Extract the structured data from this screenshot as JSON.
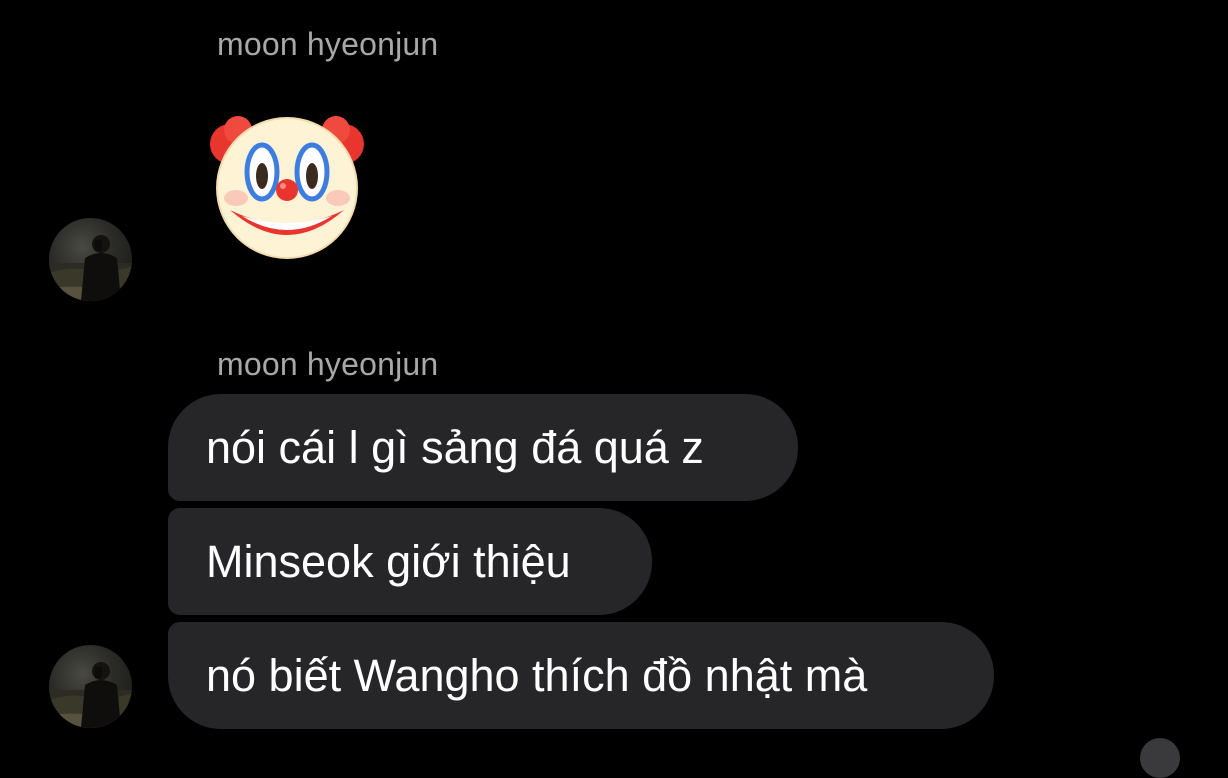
{
  "colors": {
    "background": "#000000",
    "bubble": "#262629",
    "sender_name": "#a8a8a8",
    "message_text": "#ffffff"
  },
  "groups": [
    {
      "sender": "moon hyeonjun",
      "messages": [
        {
          "type": "emoji",
          "emoji_name": "clown-face-emoji"
        }
      ]
    },
    {
      "sender": "moon hyeonjun",
      "messages": [
        {
          "type": "text",
          "text": "nói cái l gì sảng đá quá z"
        },
        {
          "type": "text",
          "text": "Minseok giới thiệu"
        },
        {
          "type": "text",
          "text": "nó biết Wangho thích đồ nhật mà"
        }
      ]
    }
  ]
}
